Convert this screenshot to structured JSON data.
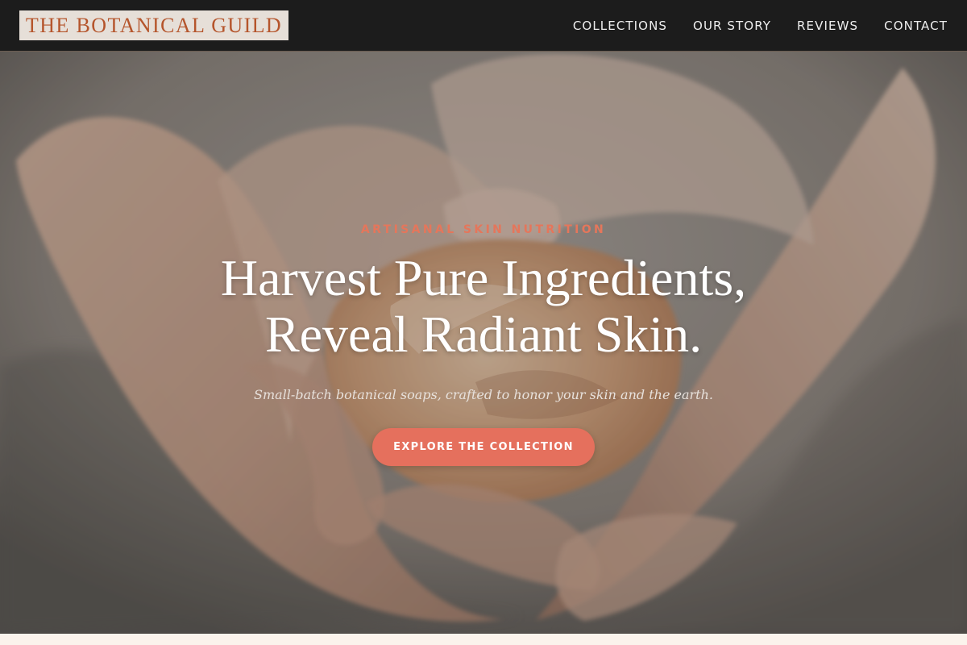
{
  "header": {
    "logo": "THE BOTANICAL GUILD",
    "nav": [
      "COLLECTIONS",
      "OUR STORY",
      "REVIEWS",
      "CONTACT"
    ]
  },
  "hero": {
    "eyebrow": "ARTISANAL SKIN NUTRITION",
    "headline_line_1": "Harvest Pure Ingredients,",
    "headline_line_2": "Reveal Radiant Skin.",
    "subtitle": "Small-batch botanical soaps, crafted to honor your skin and the earth.",
    "cta": "EXPLORE THE COLLECTION",
    "image": "hands-holding-soap"
  },
  "colors": {
    "header_background": "#1c1c1c",
    "logo_background": "#e6dfd8",
    "logo_text": "#b5552c",
    "accent": "#e5705d",
    "hero_text": "#ffffff"
  }
}
